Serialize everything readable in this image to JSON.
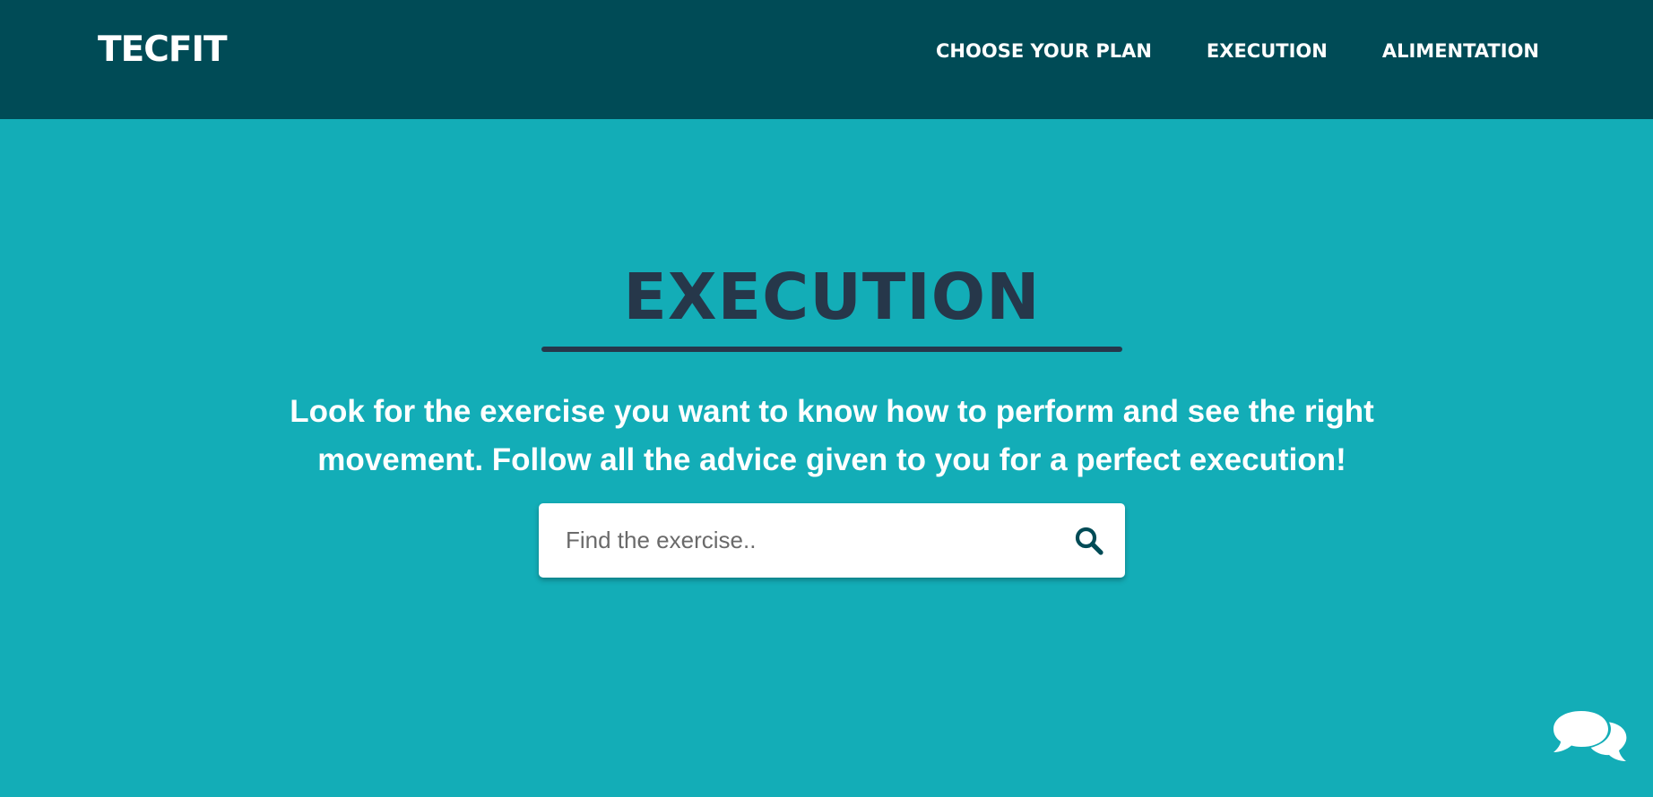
{
  "navbar": {
    "brand": "TECFIT",
    "links": [
      {
        "label": "CHOOSE YOUR PLAN"
      },
      {
        "label": "EXECUTION"
      },
      {
        "label": "ALIMENTATION"
      }
    ]
  },
  "hero": {
    "title": "EXECUTION",
    "description": "Look for the exercise you want to know how to perform and see the right movement. Follow all the advice given to you for a perfect execution!"
  },
  "search": {
    "placeholder": "Find the exercise..",
    "value": "",
    "icon": "search-icon"
  },
  "chat": {
    "icon": "chat-bubbles-icon"
  },
  "colors": {
    "navbar_bg": "#004b56",
    "page_bg": "#13adb7",
    "title_color": "#26374a",
    "text_white": "#ffffff"
  }
}
